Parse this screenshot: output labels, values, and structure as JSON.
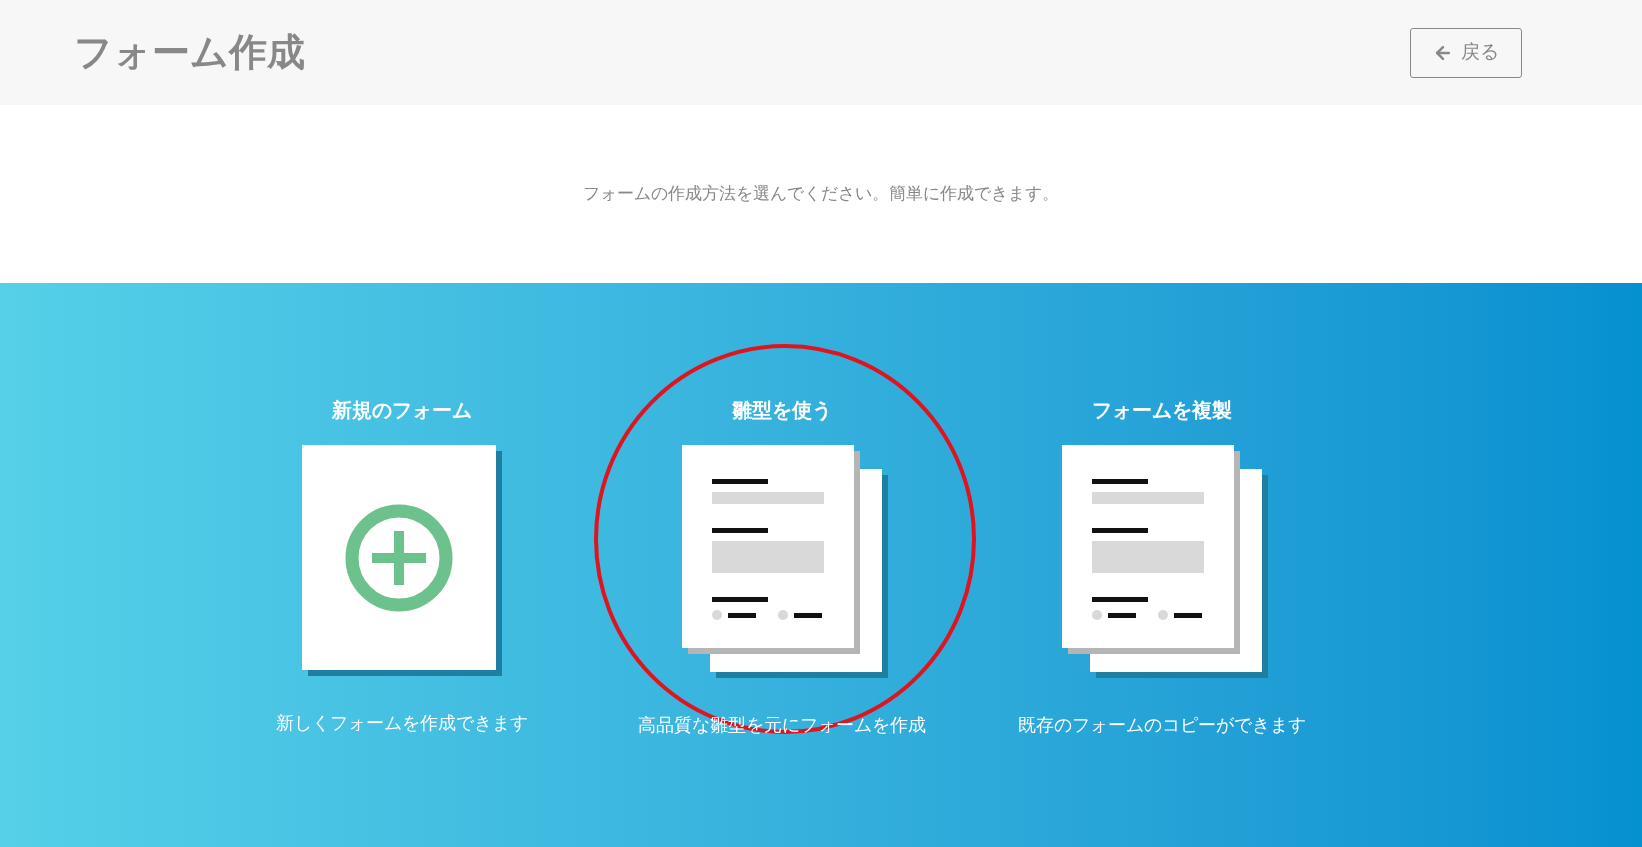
{
  "header": {
    "title": "フォーム作成",
    "back_button": {
      "label": "戻る"
    }
  },
  "intro": "フォームの作成方法を選んでください。簡単に作成できます。",
  "options": [
    {
      "kind": "new",
      "title": "新規のフォーム",
      "description": "新しくフォームを作成できます",
      "highlighted": false
    },
    {
      "kind": "template",
      "title": "雛型を使う",
      "description": "高品質な雛型を元にフォームを作成",
      "highlighted": true
    },
    {
      "kind": "copy",
      "title": "フォームを複製",
      "description": "既存のフォームのコピーができます",
      "highlighted": false
    }
  ]
}
